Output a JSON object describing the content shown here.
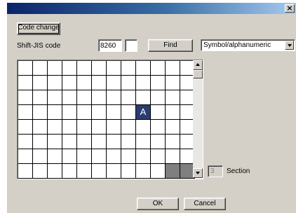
{
  "titlebar": {
    "close_glyph": "×"
  },
  "toolbar": {
    "code_change_label": "Code change"
  },
  "code": {
    "label": "Shift-JIS code",
    "value": "8260",
    "find_label": "Find",
    "category_selected": "Symbol/alphanumeric"
  },
  "grid": {
    "rows": 8,
    "cols": 12,
    "selected_char": "A",
    "selected_row": 3,
    "selected_col": 8,
    "empty_cells_from_col": 10,
    "empty_row": 7
  },
  "section": {
    "value": "3",
    "label": "Section"
  },
  "buttons": {
    "ok_label": "OK",
    "cancel_label": "Cancel"
  },
  "colors": {
    "selection": "#2b3c6e",
    "dialog_bg": "#d4d0c8",
    "empty_cell": "#7f7f7f"
  }
}
